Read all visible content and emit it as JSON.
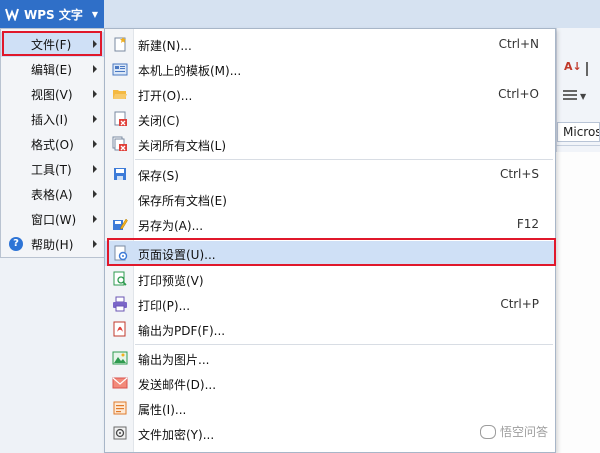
{
  "app": {
    "title": "WPS 文字"
  },
  "toolbar": {
    "font_box": "Micros"
  },
  "left_menu": {
    "items": [
      {
        "label": "文件(F)"
      },
      {
        "label": "编辑(E)"
      },
      {
        "label": "视图(V)"
      },
      {
        "label": "插入(I)"
      },
      {
        "label": "格式(O)"
      },
      {
        "label": "工具(T)"
      },
      {
        "label": "表格(A)"
      },
      {
        "label": "窗口(W)"
      },
      {
        "label": "帮助(H)"
      }
    ]
  },
  "file_menu": {
    "items": [
      {
        "label": "新建(N)...",
        "shortcut": "Ctrl+N",
        "icon": "new-document-icon"
      },
      {
        "label": "本机上的模板(M)...",
        "shortcut": "",
        "icon": "template-icon"
      },
      {
        "label": "打开(O)...",
        "shortcut": "Ctrl+O",
        "icon": "folder-open-icon"
      },
      {
        "label": "关闭(C)",
        "shortcut": "",
        "icon": "close-document-icon"
      },
      {
        "label": "关闭所有文档(L)",
        "shortcut": "",
        "icon": "close-all-icon"
      },
      {
        "label": "保存(S)",
        "shortcut": "Ctrl+S",
        "icon": "save-icon"
      },
      {
        "label": "保存所有文档(E)",
        "shortcut": "",
        "icon": ""
      },
      {
        "label": "另存为(A)...",
        "shortcut": "F12",
        "icon": "save-as-icon"
      },
      {
        "label": "页面设置(U)...",
        "shortcut": "",
        "icon": "page-setup-icon"
      },
      {
        "label": "打印预览(V)",
        "shortcut": "",
        "icon": "print-preview-icon"
      },
      {
        "label": "打印(P)...",
        "shortcut": "Ctrl+P",
        "icon": "printer-icon"
      },
      {
        "label": "输出为PDF(F)...",
        "shortcut": "",
        "icon": "pdf-icon"
      },
      {
        "label": "输出为图片...",
        "shortcut": "",
        "icon": "image-icon"
      },
      {
        "label": "发送邮件(D)...",
        "shortcut": "",
        "icon": "mail-icon"
      },
      {
        "label": "属性(I)...",
        "shortcut": "",
        "icon": "properties-icon"
      },
      {
        "label": "文件加密(Y)...",
        "shortcut": "",
        "icon": "encrypt-icon"
      }
    ]
  },
  "watermark": {
    "text": "悟空问答"
  },
  "colors": {
    "accent": "#2f6fc8",
    "highlight": "#cfe0f6",
    "annotation_red": "#e0182b"
  }
}
